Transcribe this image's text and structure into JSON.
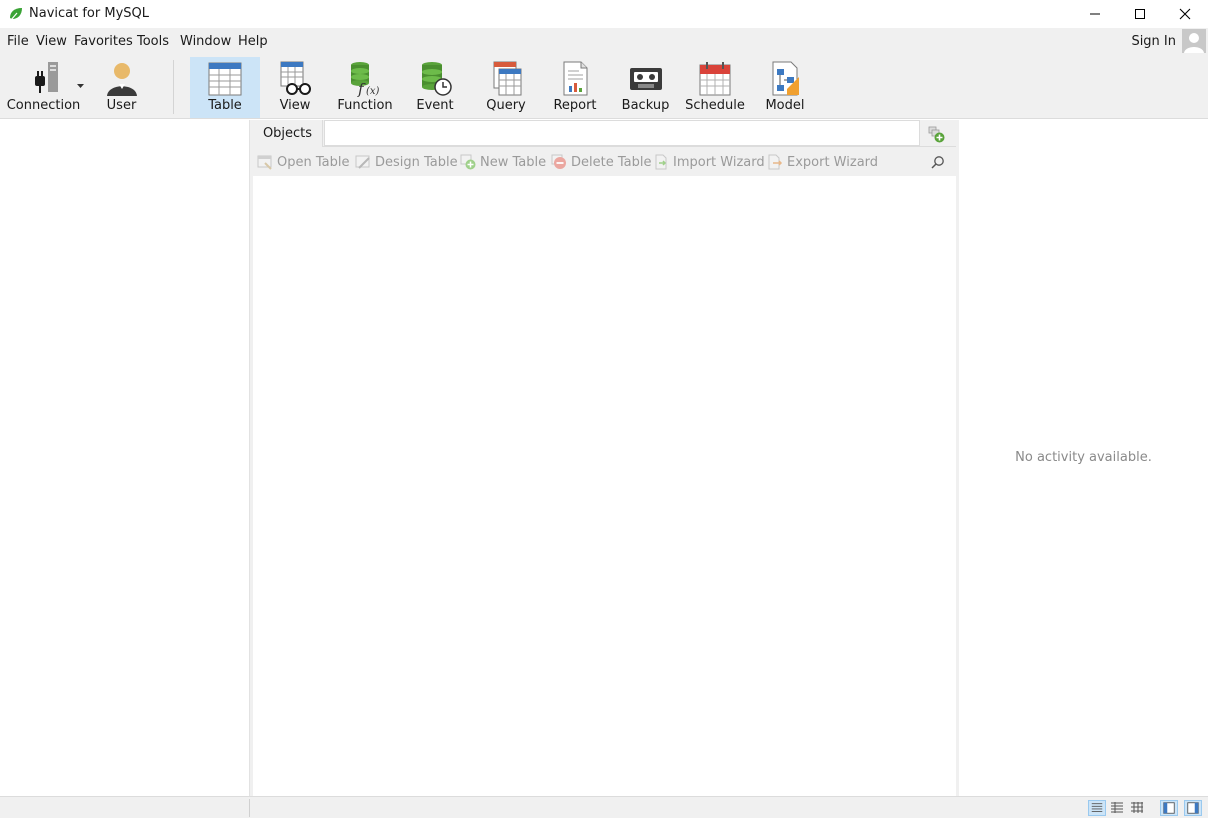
{
  "window": {
    "title": "Navicat for MySQL"
  },
  "menu": [
    "File",
    "View",
    "Favorites",
    "Tools",
    "Window",
    "Help"
  ],
  "account": {
    "sign_in": "Sign In"
  },
  "toolbar": {
    "connection": "Connection",
    "user": "User",
    "table": "Table",
    "view": "View",
    "function": "Function",
    "event": "Event",
    "query": "Query",
    "report": "Report",
    "backup": "Backup",
    "schedule": "Schedule",
    "model": "Model",
    "active": "Table"
  },
  "objects_tab": {
    "label": "Objects"
  },
  "object_toolbar": {
    "open_table": "Open Table",
    "design_table": "Design Table",
    "new_table": "New Table",
    "delete_table": "Delete Table",
    "import_wizard": "Import Wizard",
    "export_wizard": "Export Wizard"
  },
  "activity": {
    "empty_text": "No activity available."
  },
  "colors": {
    "accent": "#cce4f7",
    "chrome": "#f0f0f0",
    "disabled_text": "#9a9a9a"
  }
}
